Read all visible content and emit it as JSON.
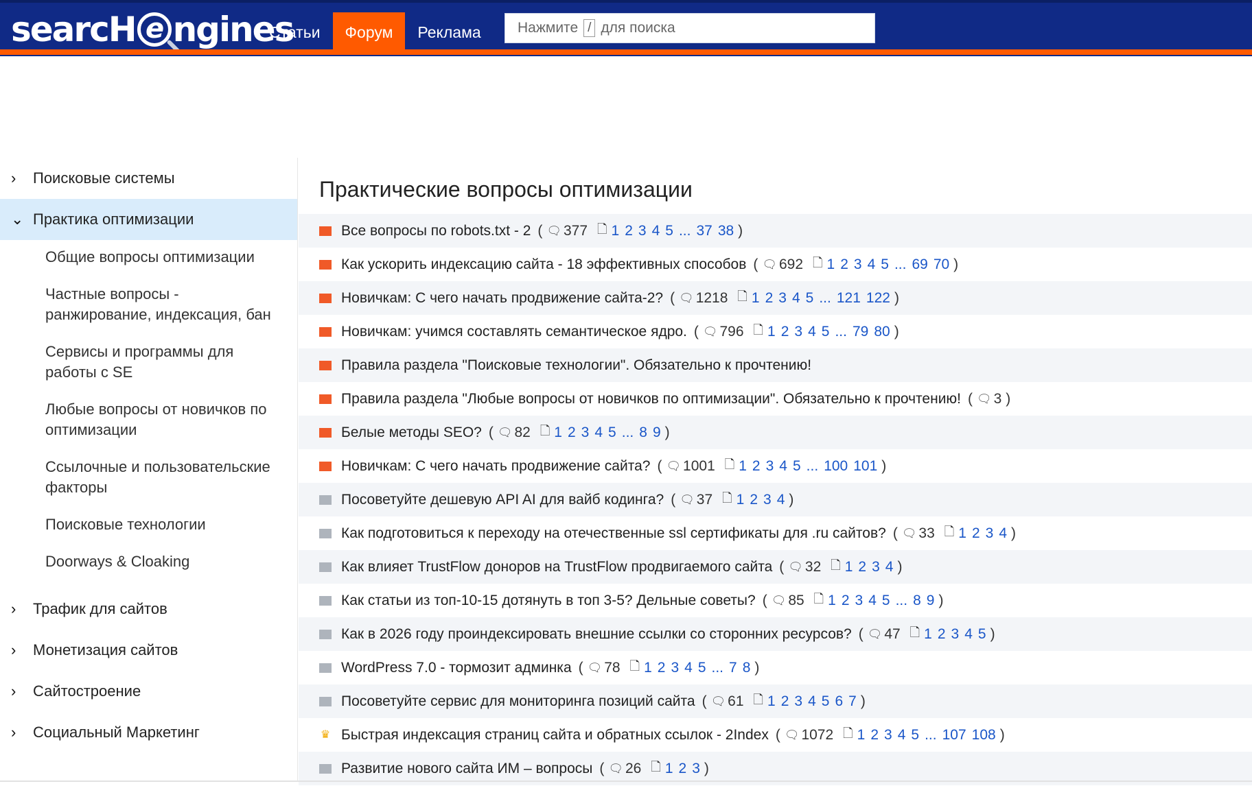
{
  "header": {
    "logo_text_left": "searcH",
    "logo_lens": "e",
    "logo_text_right": "ngines",
    "nav": [
      {
        "label": "Статьи"
      },
      {
        "label": "Форум"
      },
      {
        "label": "Реклама"
      }
    ],
    "search_prefix": "Нажмите",
    "search_key": "/",
    "search_suffix": "для поиска"
  },
  "sidebar": {
    "sections_top": [
      {
        "label": "Поисковые системы"
      },
      {
        "label": "Практика оптимизации"
      }
    ],
    "subitems": [
      {
        "label": "Общие вопросы оптимизации"
      },
      {
        "label": "Частные вопросы - ранжирование, индексация, бан"
      },
      {
        "label": "Сервисы и программы для работы с SE"
      },
      {
        "label": "Любые вопросы от новичков по оптимизации"
      },
      {
        "label": "Ссылочные и пользовательские факторы"
      },
      {
        "label": "Поисковые технологии"
      },
      {
        "label": "Doorways & Cloaking"
      }
    ],
    "sections_bottom": [
      {
        "label": "Трафик для сайтов"
      },
      {
        "label": "Монетизация сайтов"
      },
      {
        "label": "Сайтостроение"
      },
      {
        "label": "Социальный Маркетинг"
      }
    ]
  },
  "main": {
    "title": "Практические вопросы оптимизации",
    "topics": [
      {
        "flag": "hot",
        "title": "Все вопросы по robots.txt - 2",
        "replies": "377",
        "pages": [
          "1",
          "2",
          "3",
          "4",
          "5",
          "...",
          "37",
          "38"
        ]
      },
      {
        "flag": "hot",
        "title": "Как ускорить индексацию сайта - 18 эффективных способов",
        "replies": "692",
        "pages": [
          "1",
          "2",
          "3",
          "4",
          "5",
          "...",
          "69",
          "70"
        ]
      },
      {
        "flag": "hot",
        "title": "Новичкам: С чего начать продвижение сайта-2?",
        "replies": "1218",
        "pages": [
          "1",
          "2",
          "3",
          "4",
          "5",
          "...",
          "121",
          "122"
        ]
      },
      {
        "flag": "hot",
        "title": "Новичкам: учимся составлять семантическое ядро.",
        "replies": "796",
        "pages": [
          "1",
          "2",
          "3",
          "4",
          "5",
          "...",
          "79",
          "80"
        ]
      },
      {
        "flag": "hot",
        "title": "Правила раздела \"Поисковые технологии\". Обязательно к прочтению!",
        "replies": "",
        "pages": []
      },
      {
        "flag": "hot",
        "title": "Правила раздела \"Любые вопросы от новичков по оптимизации\". Обязательно к прочтению!",
        "replies": "3",
        "pages": []
      },
      {
        "flag": "hot",
        "title": "Белые методы SEO?",
        "replies": "82",
        "pages": [
          "1",
          "2",
          "3",
          "4",
          "5",
          "...",
          "8",
          "9"
        ]
      },
      {
        "flag": "hot",
        "title": "Новичкам: С чего начать продвижение сайта?",
        "replies": "1001",
        "pages": [
          "1",
          "2",
          "3",
          "4",
          "5",
          "...",
          "100",
          "101"
        ]
      },
      {
        "flag": "normal",
        "title": "Посоветуйте дешевую API AI для вайб кодинга?",
        "replies": "37",
        "pages": [
          "1",
          "2",
          "3",
          "4"
        ]
      },
      {
        "flag": "normal",
        "title": "Как подготовиться к переходу на отечественные ssl сертификаты для .ru сайтов?",
        "replies": "33",
        "pages": [
          "1",
          "2",
          "3",
          "4"
        ]
      },
      {
        "flag": "normal",
        "title": "Как влияет TrustFlow доноров на TrustFlow продвигаемого сайта",
        "replies": "32",
        "pages": [
          "1",
          "2",
          "3",
          "4"
        ]
      },
      {
        "flag": "normal",
        "title": "Как статьи из топ-10-15 дотянуть в топ 3-5? Дельные советы?",
        "replies": "85",
        "pages": [
          "1",
          "2",
          "3",
          "4",
          "5",
          "...",
          "8",
          "9"
        ]
      },
      {
        "flag": "normal",
        "title": "Как в 2026 году проиндексировать внешние ссылки со сторонних ресурсов?",
        "replies": "47",
        "pages": [
          "1",
          "2",
          "3",
          "4",
          "5"
        ]
      },
      {
        "flag": "normal",
        "title": "WordPress 7.0 - тормозит админка",
        "replies": "78",
        "pages": [
          "1",
          "2",
          "3",
          "4",
          "5",
          "...",
          "7",
          "8"
        ]
      },
      {
        "flag": "normal",
        "title": "Посоветуйте сервис для мониторинга позиций сайта",
        "replies": "61",
        "pages": [
          "1",
          "2",
          "3",
          "4",
          "5",
          "6",
          "7"
        ]
      },
      {
        "flag": "crown",
        "title": "Быстрая индексация страниц сайта и обратных ссылок - 2Index",
        "replies": "1072",
        "pages": [
          "1",
          "2",
          "3",
          "4",
          "5",
          "...",
          "107",
          "108"
        ]
      },
      {
        "flag": "normal",
        "title": "Развитие нового сайта ИМ – вопросы",
        "replies": "26",
        "pages": [
          "1",
          "2",
          "3"
        ]
      }
    ]
  },
  "icons": {
    "reply": "speech-bubble-icon",
    "pages": "document-icon",
    "chevron_right": "chevron-right-icon",
    "chevron_down": "chevron-down-icon"
  },
  "colors": {
    "header_bg": "#102a86",
    "accent": "#ff5a00",
    "link": "#1a56c8",
    "active_section": "#d9ecfb"
  }
}
